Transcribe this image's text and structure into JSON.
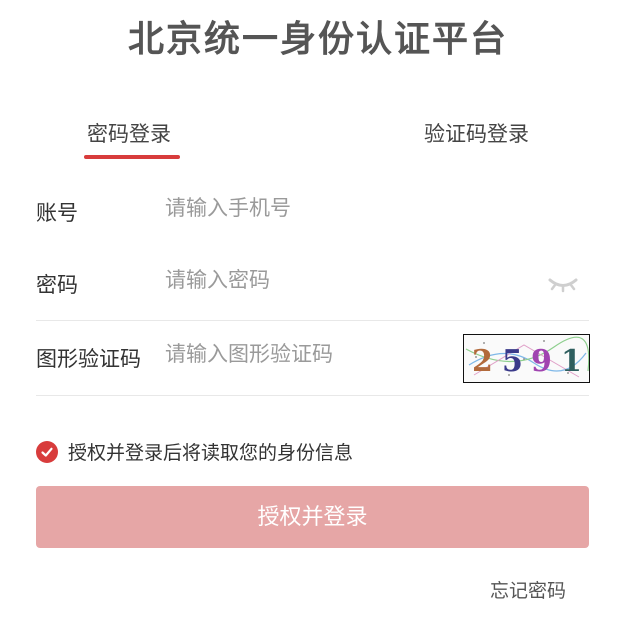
{
  "header": {
    "title": "北京统一身份认证平台"
  },
  "tabs": [
    {
      "label": "密码登录",
      "active": true
    },
    {
      "label": "验证码登录",
      "active": false
    }
  ],
  "form": {
    "account": {
      "label": "账号",
      "placeholder": "请输入手机号"
    },
    "password": {
      "label": "密码",
      "placeholder": "请输入密码",
      "toggle_icon": "eye-closed-icon"
    },
    "captcha": {
      "label": "图形验证码",
      "placeholder": "请输入图形验证码",
      "image_text": "2591"
    }
  },
  "consent": {
    "checked": true,
    "text": "授权并登录后将读取您的身份信息"
  },
  "actions": {
    "submit_label": "授权并登录",
    "forgot_label": "忘记密码"
  },
  "colors": {
    "accent": "#d83c3c",
    "button_disabled": "#e6a6a6"
  }
}
